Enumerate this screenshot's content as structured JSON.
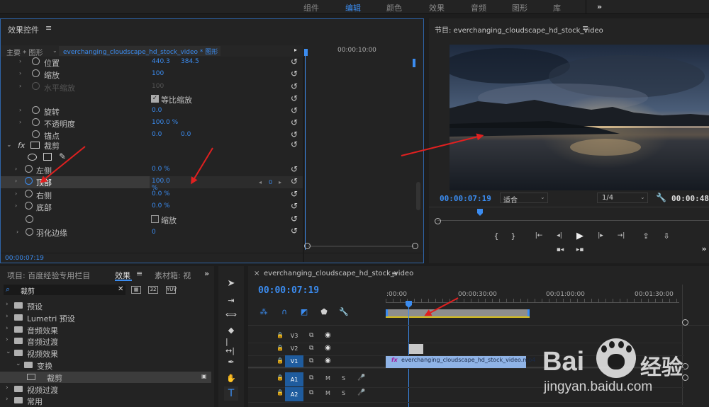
{
  "workspace_tabs": [
    "组件",
    "编辑",
    "颜色",
    "效果",
    "音频",
    "图形",
    "库"
  ],
  "workspace_active": "编辑",
  "workspace_more": "»",
  "effect_controls": {
    "title": "效果控件",
    "menu": "≡",
    "master_label": "主要 * 图形",
    "clip_label": "everchanging_cloudscape_hd_stock_video * 图形",
    "ruler_time": "00:00:10:00",
    "properties": [
      {
        "label": "位置",
        "v1": "440.3",
        "v2": "384.5",
        "tri": "›",
        "dim": false
      },
      {
        "label": "缩放",
        "v1": "100",
        "v2": "",
        "tri": "›",
        "dim": false
      },
      {
        "label": "水平缩放",
        "v1": "100",
        "v2": "",
        "tri": "›",
        "dim": true
      },
      {
        "label": "等比缩放",
        "v1": "",
        "v2": "",
        "tri": "",
        "dim": false,
        "checkbox": "✓"
      },
      {
        "label": "旋转",
        "v1": "0.0",
        "v2": "",
        "tri": "›",
        "dim": false
      },
      {
        "label": "不透明度",
        "v1": "100.0 %",
        "v2": "",
        "tri": "›",
        "dim": false
      },
      {
        "label": "锚点",
        "v1": "0.0",
        "v2": "0.0",
        "tri": "",
        "dim": false
      }
    ],
    "fx_label": "fx",
    "crop_label": "裁剪",
    "crop_properties": [
      {
        "label": "左侧",
        "v1": "0.0 %",
        "selected": false
      },
      {
        "label": "顶部",
        "v1": "100.0 %",
        "selected": true
      },
      {
        "label": "右侧",
        "v1": "0.0 %",
        "selected": false
      },
      {
        "label": "底部",
        "v1": "0.0 %",
        "selected": false
      }
    ],
    "zoom_checkbox_label": "缩放",
    "feather_label": "羽化边缘",
    "feather_value": "0",
    "keyframe_value": "0",
    "timecode": "00:00:07:19"
  },
  "program_monitor": {
    "title": "节目: everchanging_cloudscape_hd_stock_video",
    "menu": "≡",
    "timecode": "00:00:07:19",
    "fit": "适合",
    "resolution": "1/4",
    "duration": "00:00:48",
    "controls": [
      "{",
      "}",
      "|←",
      "◂|",
      "▶",
      "|▸",
      "→|",
      "⇪",
      "⇩"
    ],
    "more": "»"
  },
  "project_panel": {
    "tabs": [
      "项目: 百度经验专用栏目",
      "效果",
      "≡",
      "素材箱: 视"
    ],
    "more": "»",
    "search_value": "裁剪",
    "search_clear": "✕",
    "tree": [
      {
        "label": "预设",
        "depth": 0,
        "open": false
      },
      {
        "label": "Lumetri 预设",
        "depth": 0,
        "open": false
      },
      {
        "label": "音频效果",
        "depth": 0,
        "open": false
      },
      {
        "label": "音频过渡",
        "depth": 0,
        "open": false
      },
      {
        "label": "视频效果",
        "depth": 0,
        "open": true
      },
      {
        "label": "变换",
        "depth": 1,
        "open": true
      },
      {
        "label": "裁剪",
        "depth": 2,
        "open": false,
        "selected": true
      },
      {
        "label": "视频过渡",
        "depth": 0,
        "open": false
      },
      {
        "label": "常用",
        "depth": 0,
        "open": false
      }
    ]
  },
  "timeline": {
    "close": "×",
    "title": "everchanging_cloudscape_hd_stock_video",
    "menu": "≡",
    "timecode": "00:00:07:19",
    "ruler": [
      ":00:00",
      "00:00:30:00",
      "00:01:00:00",
      "00:01:30:00"
    ],
    "tracks": [
      {
        "name": "V3",
        "type": "video"
      },
      {
        "name": "V2",
        "type": "video"
      },
      {
        "name": "V1",
        "type": "video",
        "target": "V1"
      },
      {
        "name": "A1",
        "type": "audio",
        "target": "A1"
      },
      {
        "name": "A2",
        "type": "audio",
        "target": "A2"
      }
    ],
    "clip_label": "everchanging_cloudscape_hd_stock_video.mp4",
    "fx_badge": "fx",
    "m": "M",
    "s": "S"
  },
  "watermark": {
    "brand": "Bai",
    "brand2": "经验",
    "url": "jingyan.baidu.com"
  },
  "colors": {
    "accent": "#3b8cf0",
    "arrow": "#e02020",
    "clip_video": "#8fb3e6",
    "clip_graphic": "#a8a8a8"
  }
}
